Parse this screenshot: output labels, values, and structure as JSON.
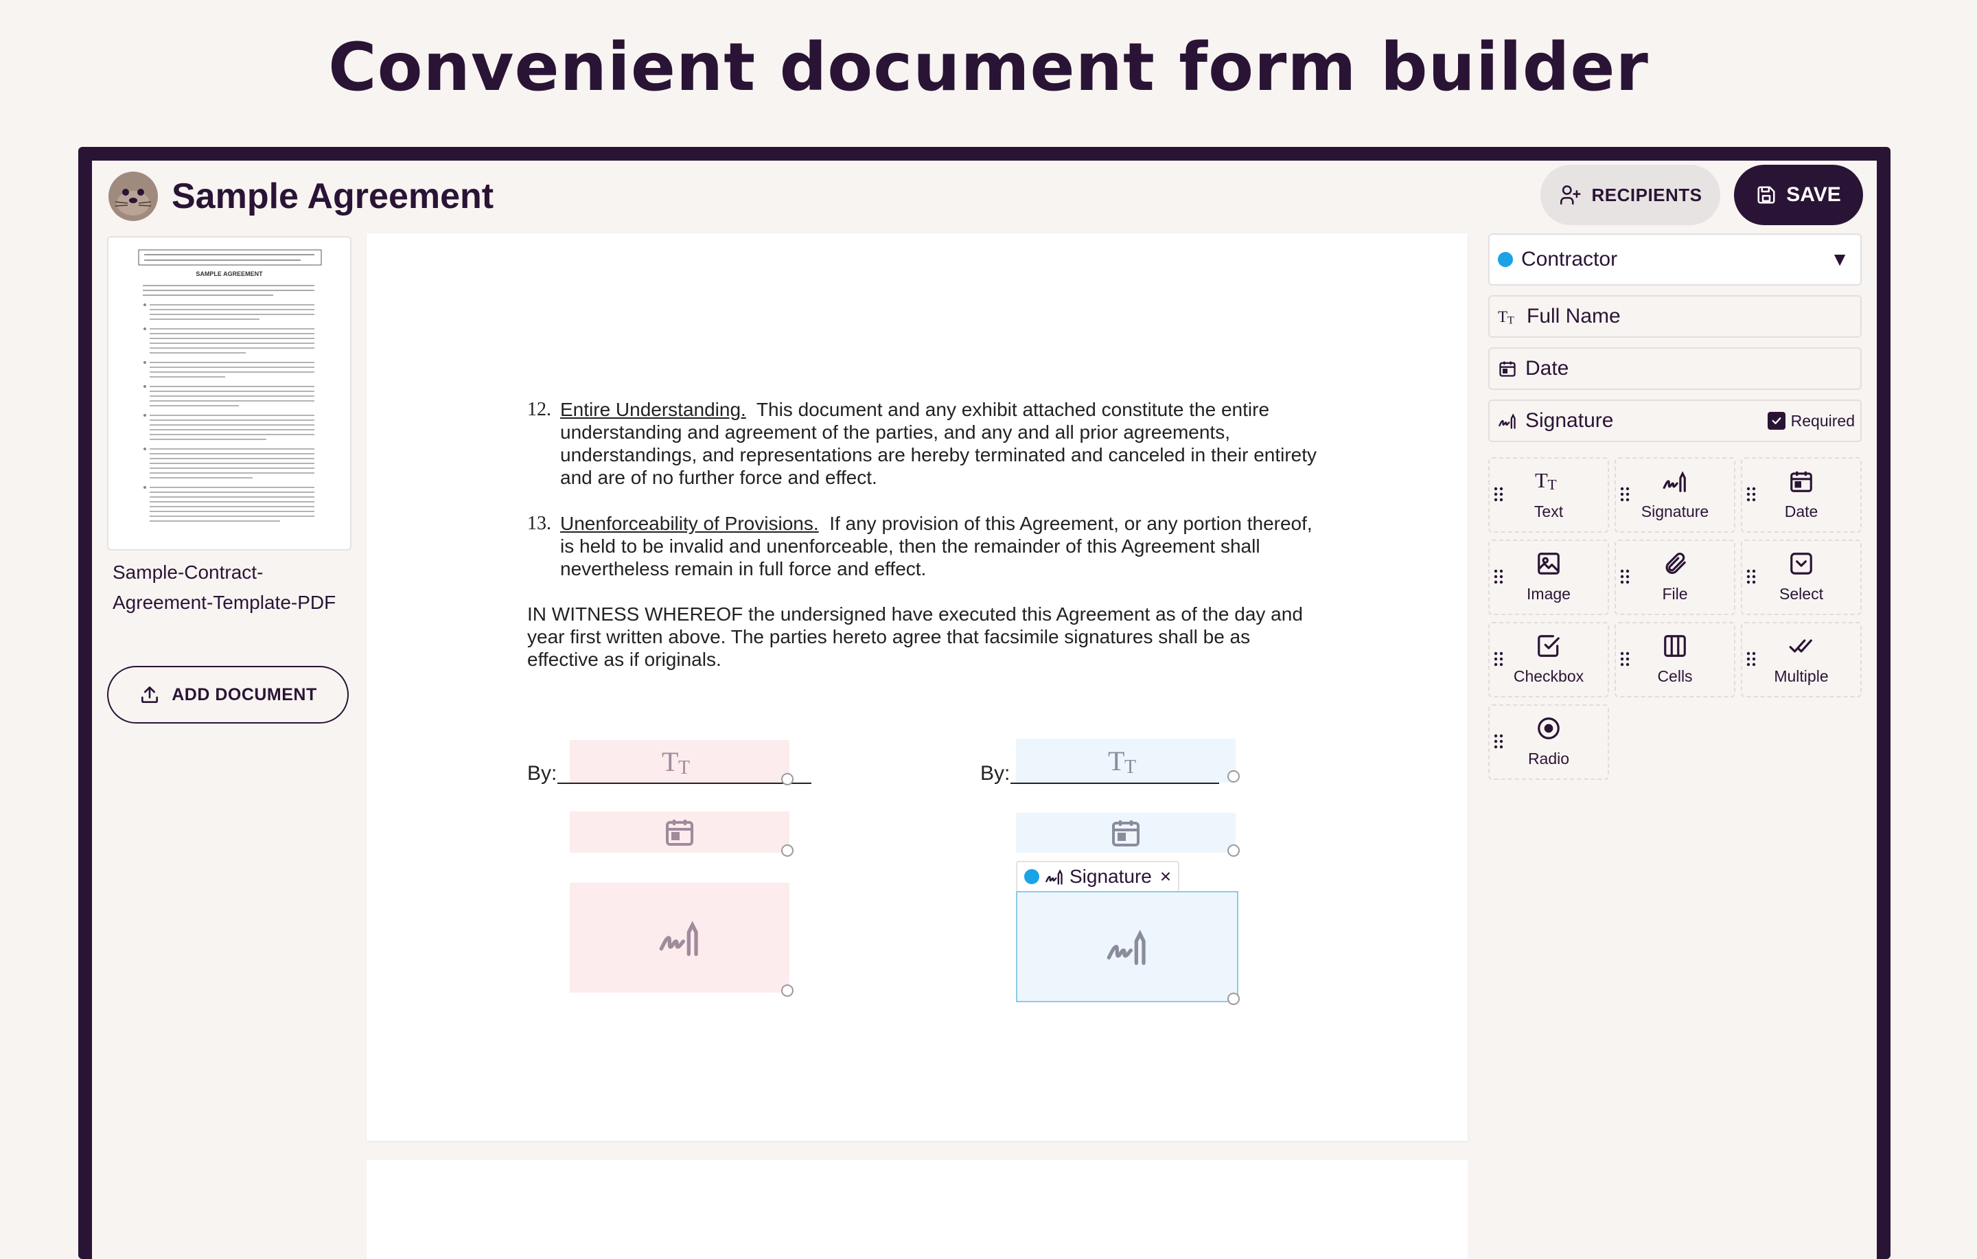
{
  "hero": {
    "title": "Convenient document form builder"
  },
  "header": {
    "title": "Sample Agreement",
    "recipients_label": "RECIPIENTS",
    "save_label": "SAVE"
  },
  "sidebar": {
    "document_name": "Sample-Contract-Agreement-Template-PDF",
    "add_document_label": "ADD DOCUMENT"
  },
  "thumbnail": {
    "heading": "SAMPLE AGREEMENT"
  },
  "document": {
    "p12": {
      "number": "12.",
      "heading": "Entire Understanding.",
      "text": "This document and any exhibit attached constitute the entire understanding and agreement of the parties, and any and all prior agreements, understandings, and representations are hereby terminated and canceled in their entirety and are of no further force and effect."
    },
    "p13": {
      "number": "13.",
      "heading": "Unenforceability of Provisions.",
      "text": "If any provision of this Agreement, or any portion thereof, is held to be invalid and unenforceable, then the remainder of this Agreement shall nevertheless remain in full force and effect."
    },
    "witness": "IN WITNESS WHEREOF the undersigned have executed this Agreement as of the day and year first written above.  The parties hereto agree that facsimile signatures shall be as effective as if originals.",
    "by_left": "By:",
    "by_right": "By:",
    "selected_field_label": "Signature"
  },
  "panel": {
    "recipient": "Contractor",
    "recipient_color": "#1aa3e6",
    "fields": [
      {
        "label": "Full Name",
        "icon": "text-type-icon"
      },
      {
        "label": "Date",
        "icon": "calendar-icon"
      },
      {
        "label": "Signature",
        "icon": "signature-icon",
        "required_label": "Required",
        "required": true
      }
    ],
    "tools": [
      {
        "label": "Text",
        "icon": "text-type-icon"
      },
      {
        "label": "Signature",
        "icon": "signature-icon"
      },
      {
        "label": "Date",
        "icon": "calendar-icon"
      },
      {
        "label": "Image",
        "icon": "image-icon"
      },
      {
        "label": "File",
        "icon": "paperclip-icon"
      },
      {
        "label": "Select",
        "icon": "select-icon"
      },
      {
        "label": "Checkbox",
        "icon": "checkbox-icon"
      },
      {
        "label": "Cells",
        "icon": "cells-icon"
      },
      {
        "label": "Multiple",
        "icon": "double-check-icon"
      },
      {
        "label": "Radio",
        "icon": "radio-icon"
      }
    ]
  },
  "colors": {
    "brand": "#2a1435",
    "signer_left": "#fdeced",
    "signer_right": "#eef6fd"
  }
}
